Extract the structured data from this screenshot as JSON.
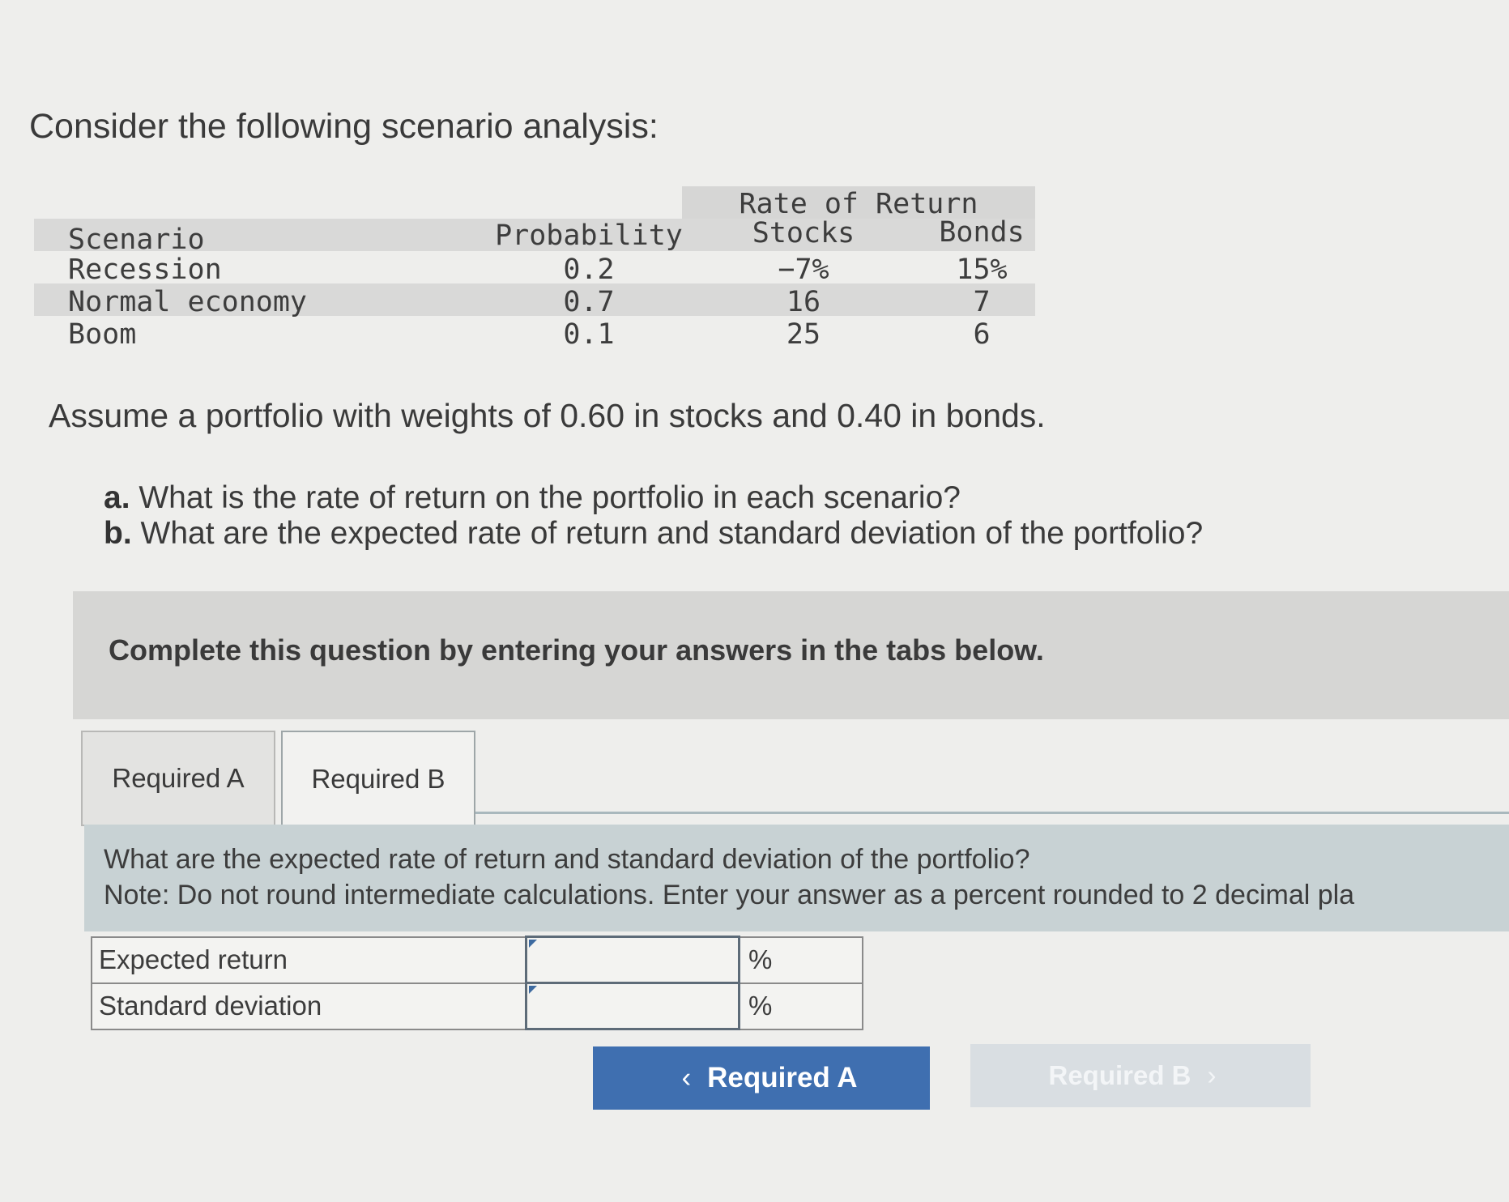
{
  "intro": "Consider the following scenario analysis:",
  "scenario_table": {
    "group_header": "Rate of Return",
    "headers": {
      "scenario": "Scenario",
      "probability": "Probability",
      "stocks": "Stocks",
      "bonds": "Bonds"
    },
    "rows": [
      {
        "scenario": "Recession",
        "probability": "0.2",
        "stocks": "−7%",
        "bonds": "15%"
      },
      {
        "scenario": "Normal economy",
        "probability": "0.7",
        "stocks": "16",
        "bonds": "7"
      },
      {
        "scenario": "Boom",
        "probability": "0.1",
        "stocks": "25",
        "bonds": "6"
      }
    ]
  },
  "assumption": "Assume a portfolio with weights of 0.60 in stocks and 0.40 in bonds.",
  "questions": [
    {
      "label": "a.",
      "text": "What is the rate of return on the portfolio in each scenario?"
    },
    {
      "label": "b.",
      "text": "What are the expected rate of return and standard deviation of the portfolio?"
    }
  ],
  "banner": "Complete this question by entering your answers in the tabs below.",
  "tabs": [
    {
      "label": "Required A"
    },
    {
      "label": "Required B"
    }
  ],
  "active_tab": "Required B",
  "panel": {
    "question": "What are the expected rate of return and standard deviation of the portfolio?",
    "note": "Note: Do not round intermediate calculations. Enter your answer as a percent rounded to 2 decimal pla"
  },
  "answer_table": {
    "rows": [
      {
        "label": "Expected return",
        "value": "",
        "unit": "%"
      },
      {
        "label": "Standard deviation",
        "value": "",
        "unit": "%"
      }
    ]
  },
  "nav": {
    "prev_label": "Required A",
    "next_label": "Required B",
    "prev_icon": "chevron-left-icon",
    "next_icon": "chevron-right-icon"
  },
  "colors": {
    "primary_button": "#3f6fb0",
    "disabled_button": "#d9dee2",
    "panel": "#c8d2d4"
  }
}
